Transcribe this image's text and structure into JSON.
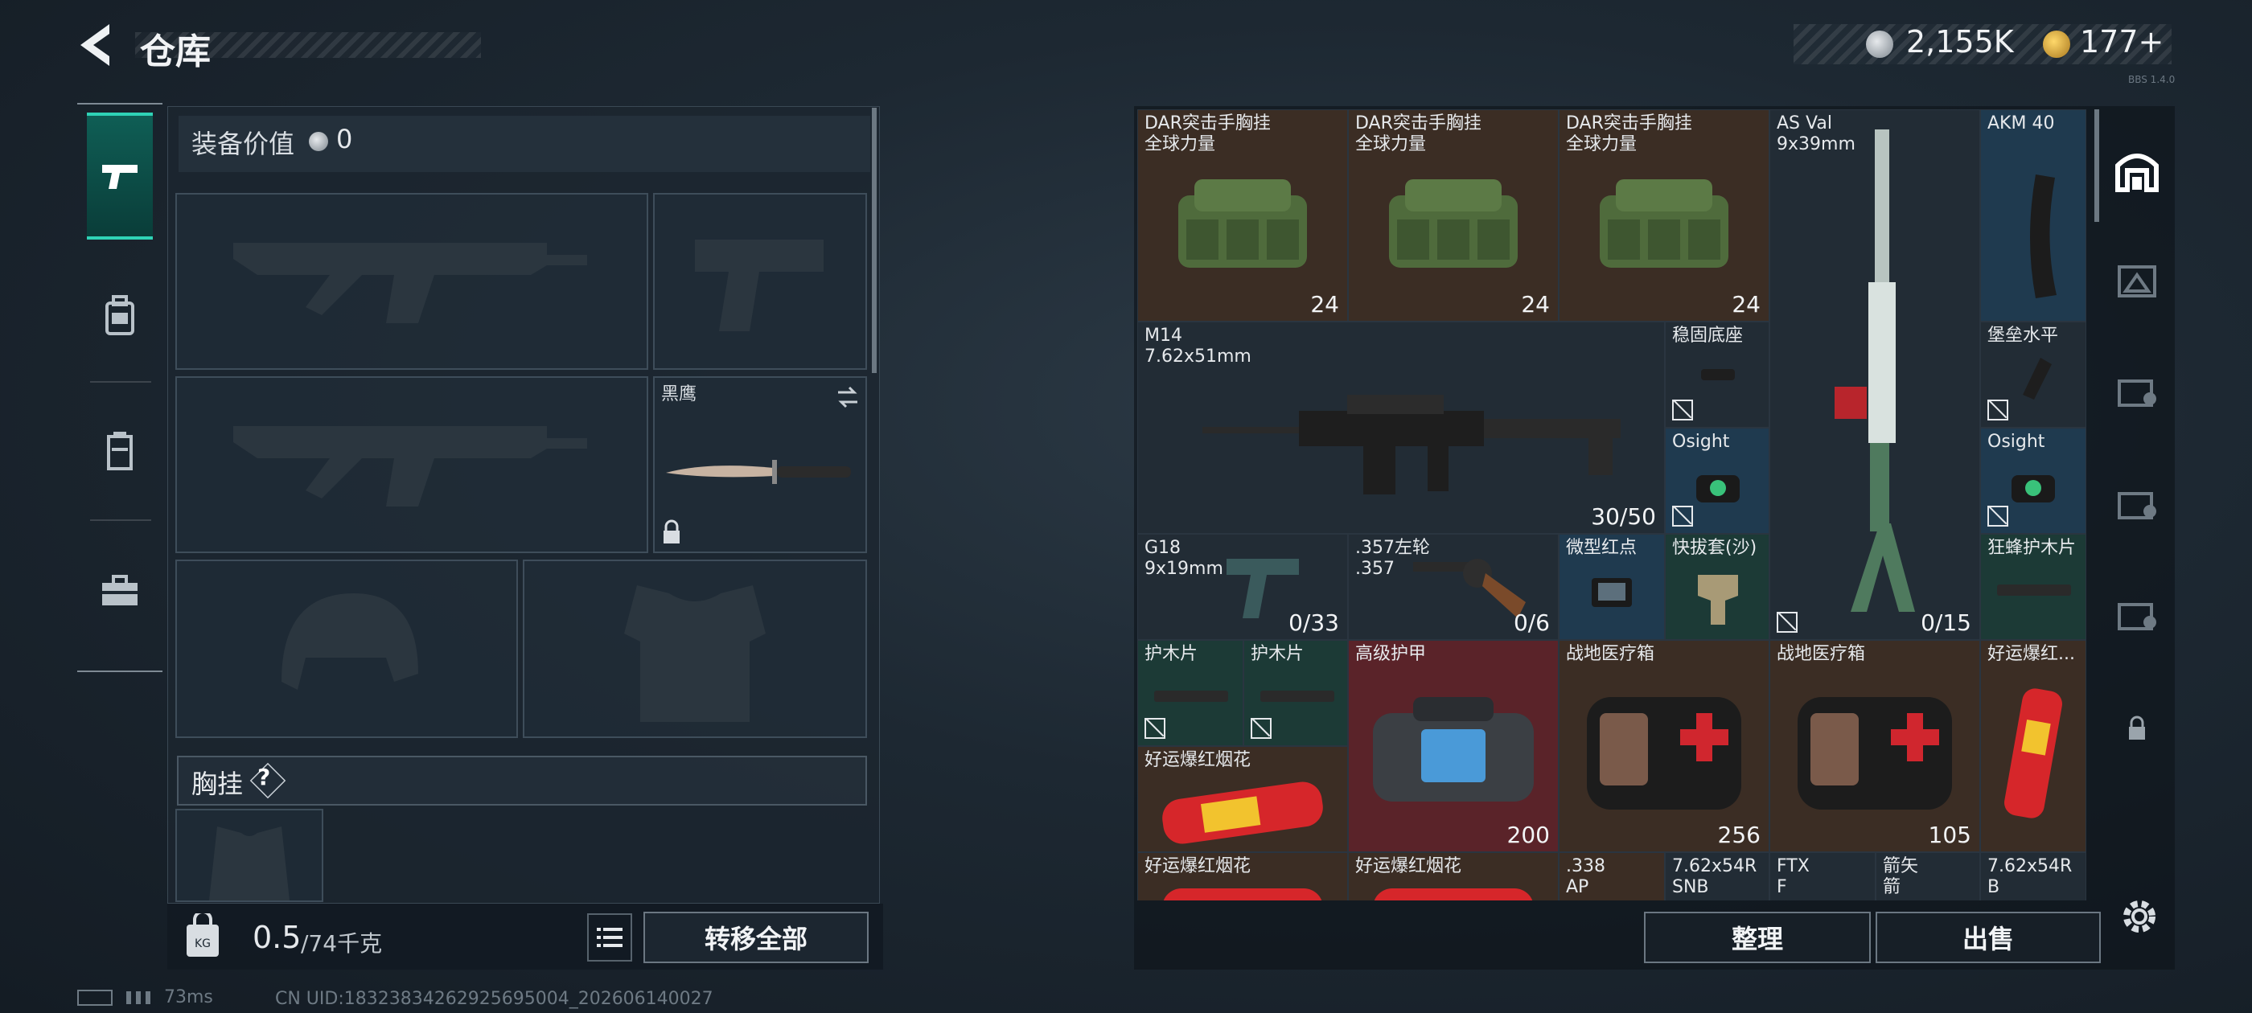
{
  "header": {
    "title": "仓库",
    "currency1": "2,155K",
    "currency2": "177+",
    "version": "BBS 1.4.0"
  },
  "equipment": {
    "value_label": "装备价值",
    "value": "0",
    "knife_name": "黑鹰",
    "chest_label": "胸挂",
    "help": "?"
  },
  "footer": {
    "weight_current": "0.5",
    "weight_max": "/74千克",
    "move_all": "转移全部",
    "latency": "73ms",
    "uid": "CN UID:18323834262925695004_202606140027"
  },
  "actions": {
    "sort": "整理",
    "sell": "出售"
  },
  "items": [
    {
      "name": "DAR突击手胸挂\n全球力量",
      "count": "24"
    },
    {
      "name": "DAR突击手胸挂\n全球力量",
      "count": "24"
    },
    {
      "name": "DAR突击手胸挂\n全球力量",
      "count": "24"
    },
    {
      "name": "AS Val\n9x39mm",
      "count": "0/15"
    },
    {
      "name": "AKM 40",
      "count": ""
    },
    {
      "name": "M14\n7.62x51mm",
      "count": "30/50"
    },
    {
      "name": "稳固底座",
      "count": ""
    },
    {
      "name": "堡垒水平",
      "count": ""
    },
    {
      "name": "Osight",
      "count": ""
    },
    {
      "name": "Osight",
      "count": ""
    },
    {
      "name": "G18\n9x19mm",
      "count": "0/33"
    },
    {
      "name": ".357左轮\n.357",
      "count": "0/6"
    },
    {
      "name": "微型红点",
      "count": ""
    },
    {
      "name": "快拔套(沙)",
      "count": ""
    },
    {
      "name": "狂蜂护木片",
      "count": ""
    },
    {
      "name": "护木片",
      "count": ""
    },
    {
      "name": "护木片",
      "count": ""
    },
    {
      "name": "高级护甲",
      "count": "200"
    },
    {
      "name": "战地医疗箱",
      "count": "256"
    },
    {
      "name": "战地医疗箱",
      "count": "105"
    },
    {
      "name": "好运爆红...",
      "count": ""
    },
    {
      "name": "好运爆红烟花",
      "count": ""
    },
    {
      "name": "好运爆红烟花",
      "count": ""
    },
    {
      "name": "好运爆红烟花",
      "count": ""
    },
    {
      "name": ".338\nAP",
      "count": ""
    },
    {
      "name": "7.62x54R\nSNB",
      "count": ""
    },
    {
      "name": "FTX\nF",
      "count": ""
    },
    {
      "name": "箭矢\n箭",
      "count": ""
    },
    {
      "name": "7.62x54R\nB",
      "count": ""
    }
  ],
  "colors": {
    "accent": "#2fd3b6",
    "brown_cell": "#3b2d24",
    "blue_cell": "#1f3a4f",
    "red_cell": "#5a2329"
  }
}
